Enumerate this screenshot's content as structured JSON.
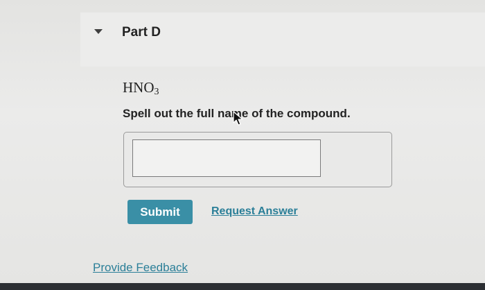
{
  "part": {
    "title": "Part D"
  },
  "question": {
    "formula": {
      "base": "HNO",
      "subscript": "3"
    },
    "instruction": "Spell out the full name of the compound."
  },
  "answer": {
    "value": "",
    "placeholder": ""
  },
  "actions": {
    "submit_label": "Submit",
    "request_answer_label": "Request Answer"
  },
  "footer": {
    "feedback_label": "Provide Feedback"
  },
  "colors": {
    "accent": "#3a8fa6",
    "link": "#2b7f98",
    "text": "#222222"
  },
  "icons": {
    "collapse": "caret-down-icon",
    "pointer": "mouse-cursor-icon"
  }
}
